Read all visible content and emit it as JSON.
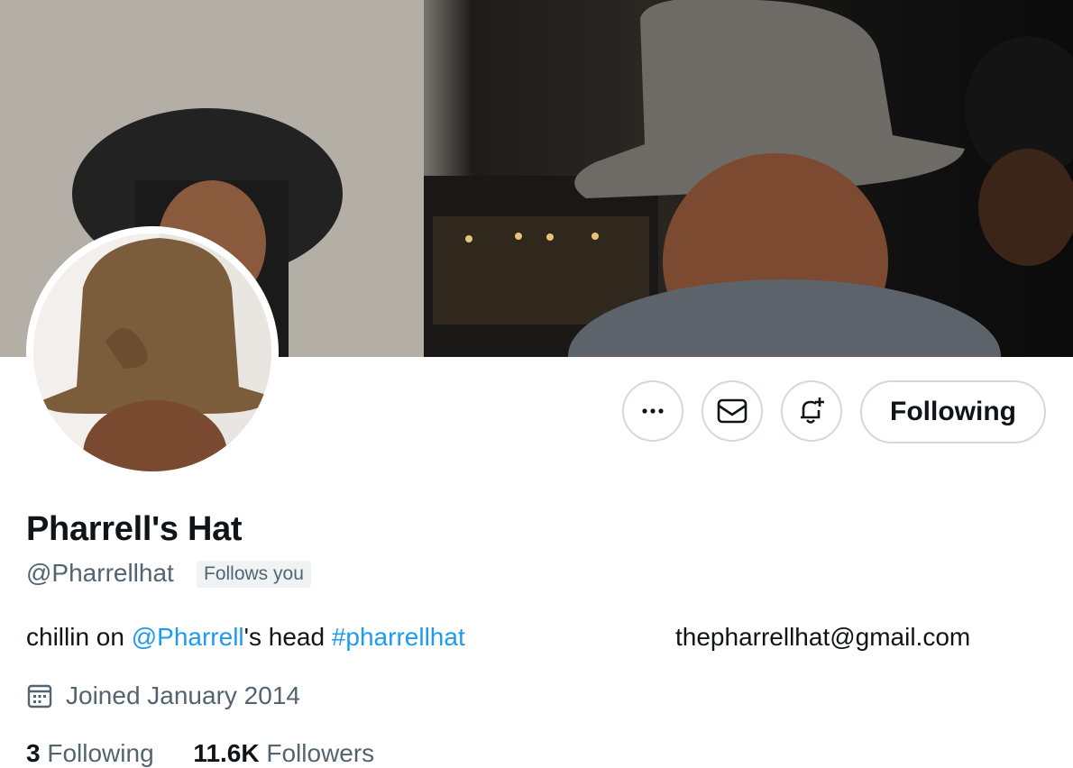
{
  "profile": {
    "name": "Pharrell's Hat",
    "handle": "@Pharrellhat",
    "follows_you": "Follows you",
    "bio": {
      "prefix": "chillin on ",
      "mention": "@Pharrell",
      "middle": "'s head ",
      "hashtag": "#pharrellhat"
    },
    "email": "thepharrellhat@gmail.com",
    "joined": "Joined January 2014",
    "stats": {
      "following_count": "3",
      "following_label": "Following",
      "followers_count": "11.6K",
      "followers_label": "Followers"
    }
  },
  "actions": {
    "more_icon": "more-icon",
    "message_icon": "mail-icon",
    "notify_icon": "bell-plus-icon",
    "follow_label": "Following"
  },
  "colors": {
    "accent": "#1d9bf0",
    "secondary_text": "#536471",
    "border": "#cfd9de"
  }
}
